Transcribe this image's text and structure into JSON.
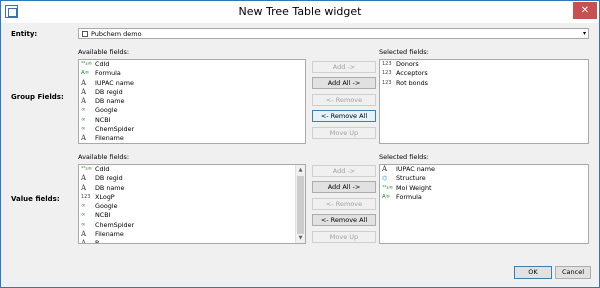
{
  "window": {
    "title": "New Tree Table widget",
    "close_glyph": "✕"
  },
  "entity": {
    "label": "Entity:",
    "value": "Pubchem demo",
    "dropdown_glyph": "▾"
  },
  "group": {
    "label": "Group Fields:",
    "available_label": "Available fields:",
    "selected_label": "Selected fields:",
    "available": [
      {
        "icon": "calc",
        "glyph": "¹²₃∞",
        "label": "CdId"
      },
      {
        "icon": "text-calc",
        "glyph": "A∞",
        "label": "Formula"
      },
      {
        "icon": "text",
        "glyph": "A",
        "label": "IUPAC name"
      },
      {
        "icon": "text",
        "glyph": "A",
        "label": "DB regid"
      },
      {
        "icon": "text",
        "glyph": "A",
        "label": "DB name"
      },
      {
        "icon": "link",
        "glyph": "∞",
        "label": "Google"
      },
      {
        "icon": "link",
        "glyph": "∞",
        "label": "NCBI"
      },
      {
        "icon": "link",
        "glyph": "∞",
        "label": "ChemSpider"
      },
      {
        "icon": "text",
        "glyph": "A",
        "label": "Filename"
      }
    ],
    "selected": [
      {
        "icon": "number",
        "glyph": "123",
        "label": "Donors"
      },
      {
        "icon": "number",
        "glyph": "123",
        "label": "Acceptors"
      },
      {
        "icon": "number",
        "glyph": "123",
        "label": "Rot bonds"
      }
    ],
    "buttons": {
      "add": "Add ->",
      "add_all": "Add All ->",
      "remove": "<- Remove",
      "remove_all": "<- Remove All",
      "move_up": "Move Up"
    }
  },
  "value": {
    "label": "Value fields:",
    "available_label": "Available fields:",
    "selected_label": "Selected fields:",
    "available": [
      {
        "icon": "calc",
        "glyph": "¹²₃∞",
        "label": "CdId"
      },
      {
        "icon": "text",
        "glyph": "A",
        "label": "DB regid"
      },
      {
        "icon": "text",
        "glyph": "A",
        "label": "DB name"
      },
      {
        "icon": "number",
        "glyph": "123",
        "label": "XLogP"
      },
      {
        "icon": "link",
        "glyph": "∞",
        "label": "Google"
      },
      {
        "icon": "link",
        "glyph": "∞",
        "label": "NCBI"
      },
      {
        "icon": "link",
        "glyph": "∞",
        "label": "ChemSpider"
      },
      {
        "icon": "text",
        "glyph": "A",
        "label": "Filename"
      },
      {
        "icon": "text",
        "glyph": "A",
        "label": "P..."
      }
    ],
    "selected": [
      {
        "icon": "text",
        "glyph": "A",
        "label": "IUPAC name"
      },
      {
        "icon": "molecule",
        "glyph": "⌬",
        "label": "Structure"
      },
      {
        "icon": "calc",
        "glyph": "¹²₃∞",
        "label": "Mol Weight"
      },
      {
        "icon": "text-calc",
        "glyph": "A∞",
        "label": "Formula"
      }
    ],
    "buttons": {
      "add": "Add ->",
      "add_all": "Add All ->",
      "remove": "<- Remove",
      "remove_all": "<- Remove All",
      "move_up": "Move Up"
    }
  },
  "footer": {
    "ok": "OK",
    "cancel": "Cancel"
  }
}
